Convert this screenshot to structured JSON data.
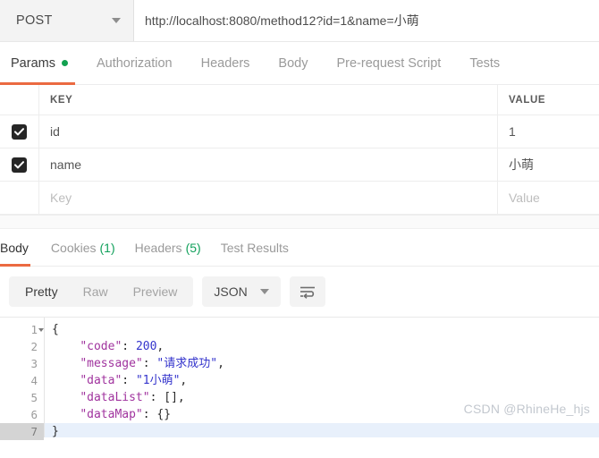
{
  "request": {
    "method": "POST",
    "url": "http://localhost:8080/method12?id=1&name=小萌",
    "tabs": [
      {
        "label": "Params",
        "active": true,
        "dot": true
      },
      {
        "label": "Authorization",
        "active": false,
        "dot": false
      },
      {
        "label": "Headers",
        "active": false,
        "dot": false
      },
      {
        "label": "Body",
        "active": false,
        "dot": false
      },
      {
        "label": "Pre-request Script",
        "active": false,
        "dot": false
      },
      {
        "label": "Tests",
        "active": false,
        "dot": false
      }
    ],
    "params": {
      "columns": {
        "key": "KEY",
        "value": "VALUE"
      },
      "rows": [
        {
          "checked": true,
          "key": "id",
          "value": "1",
          "placeholder": false
        },
        {
          "checked": true,
          "key": "name",
          "value": "小萌",
          "placeholder": false
        },
        {
          "checked": false,
          "key": "Key",
          "value": "Value",
          "placeholder": true
        }
      ]
    }
  },
  "response": {
    "tabs": [
      {
        "label": "Body",
        "count": "",
        "active": true
      },
      {
        "label": "Cookies",
        "count": "(1)",
        "active": false
      },
      {
        "label": "Headers",
        "count": "(5)",
        "active": false
      },
      {
        "label": "Test Results",
        "count": "",
        "active": false
      }
    ],
    "toolbar": {
      "pretty": "Pretty",
      "raw": "Raw",
      "preview": "Preview",
      "format": "JSON",
      "wrap_icon": "word-wrap-icon"
    },
    "body": {
      "line_numbers": [
        "1",
        "2",
        "3",
        "4",
        "5",
        "6",
        "7"
      ],
      "highlighted_line": 7,
      "lines": [
        {
          "n": 1,
          "segments": [
            {
              "t": "punc",
              "v": "{"
            }
          ]
        },
        {
          "n": 2,
          "segments": [
            {
              "t": "plain",
              "v": "    "
            },
            {
              "t": "key",
              "v": "\"code\""
            },
            {
              "t": "punc",
              "v": ": "
            },
            {
              "t": "num",
              "v": "200"
            },
            {
              "t": "punc",
              "v": ","
            }
          ]
        },
        {
          "n": 3,
          "segments": [
            {
              "t": "plain",
              "v": "    "
            },
            {
              "t": "key",
              "v": "\"message\""
            },
            {
              "t": "punc",
              "v": ": "
            },
            {
              "t": "str",
              "v": "\"请求成功\""
            },
            {
              "t": "punc",
              "v": ","
            }
          ]
        },
        {
          "n": 4,
          "segments": [
            {
              "t": "plain",
              "v": "    "
            },
            {
              "t": "key",
              "v": "\"data\""
            },
            {
              "t": "punc",
              "v": ": "
            },
            {
              "t": "str",
              "v": "\"1小萌\""
            },
            {
              "t": "punc",
              "v": ","
            }
          ]
        },
        {
          "n": 5,
          "segments": [
            {
              "t": "plain",
              "v": "    "
            },
            {
              "t": "key",
              "v": "\"dataList\""
            },
            {
              "t": "punc",
              "v": ": [],"
            }
          ]
        },
        {
          "n": 6,
          "segments": [
            {
              "t": "plain",
              "v": "    "
            },
            {
              "t": "key",
              "v": "\"dataMap\""
            },
            {
              "t": "punc",
              "v": ": {}"
            }
          ]
        },
        {
          "n": 7,
          "segments": [
            {
              "t": "punc",
              "v": "}"
            }
          ]
        }
      ]
    }
  },
  "watermark": "CSDN @RhineHe_hjs",
  "colors": {
    "accent": "#eb6a41",
    "green": "#12a150",
    "checkbox": "#262626",
    "json_key": "#a0339e",
    "json_value": "#3434cc",
    "toolbar_bg": "#f3f3f3",
    "highlight_line": "#e8f0fb"
  }
}
